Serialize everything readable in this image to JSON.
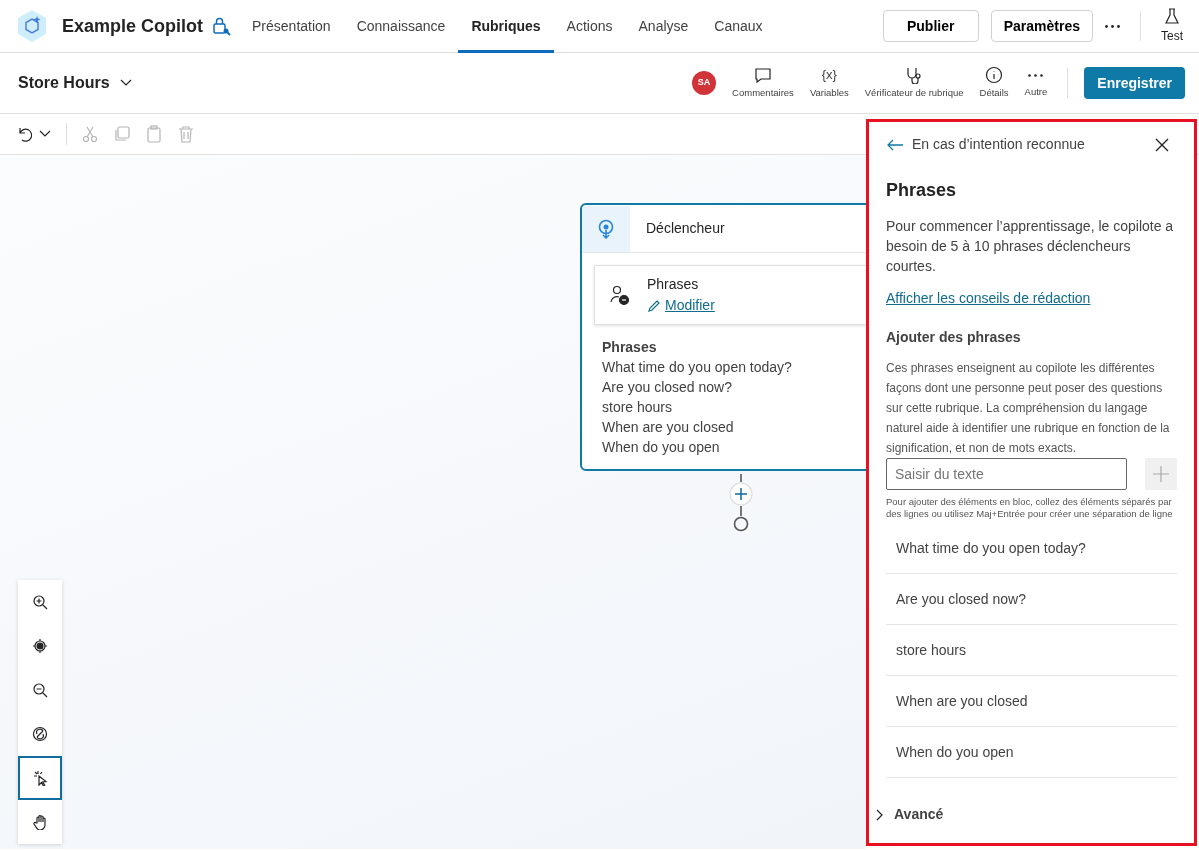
{
  "app": {
    "name": "Example Copilot"
  },
  "nav_tabs": [
    {
      "label": "Présentation",
      "selected": false
    },
    {
      "label": "Connaissance",
      "selected": false
    },
    {
      "label": "Rubriques",
      "selected": true
    },
    {
      "label": "Actions",
      "selected": false
    },
    {
      "label": "Analyse",
      "selected": false
    },
    {
      "label": "Canaux",
      "selected": false
    }
  ],
  "header_buttons": [
    "Publier",
    "Paramètres"
  ],
  "test_label": "Test",
  "topic": {
    "title": "Store Hours",
    "avatar": "SA",
    "tools": [
      {
        "kind": "comment",
        "label": "Commentaires"
      },
      {
        "kind": "variables",
        "glyph": "{x}",
        "label": "Variables"
      },
      {
        "kind": "checker",
        "label": "Vérificateur de rubrique"
      },
      {
        "kind": "info",
        "label": "Détails"
      },
      {
        "kind": "more",
        "label": "Autre"
      }
    ],
    "save": "Enregistrer"
  },
  "canvas": {
    "node": {
      "title": "Déclencheur",
      "card_title": "Phrases",
      "card_link": "Modifier",
      "body_title": "Phrases",
      "lines": [
        "What time do you open today?",
        "Are you closed now?",
        "store hours",
        "When are you closed",
        "When do you open"
      ]
    },
    "zoom_tools": [
      {
        "kind": "zoom-in",
        "selected": false
      },
      {
        "kind": "center",
        "selected": false
      },
      {
        "kind": "zoom-out",
        "selected": false
      },
      {
        "kind": "minimap",
        "selected": false
      },
      {
        "kind": "select",
        "selected": true
      },
      {
        "kind": "pan",
        "selected": false
      }
    ]
  },
  "panel": {
    "back": "En cas d’intention reconnue",
    "title": "Phrases",
    "description": "Pour commencer l’apprentissage, le copilote a besoin de 5 à 10 phrases déclencheurs courtes.",
    "link": "Afficher les conseils de rédaction",
    "section_title": "Ajouter des phrases",
    "help": "Ces phrases enseignent au copilote les différentes façons dont une personne peut poser des questions sur cette rubrique. La compréhension du langage naturel aide à identifier une rubrique en fonction de la signification, et non de mots exacts.",
    "placeholder": "Saisir du texte",
    "hint": "Pour ajouter des éléments en bloc, collez des éléments séparés par des lignes ou utilisez Maj+Entrée pour créer une séparation de ligne",
    "phrases": [
      "What time do you open today?",
      "Are you closed now?",
      "store hours",
      "When are you closed",
      "When do you open"
    ],
    "advanced": {
      "label": "Avancé",
      "expanded": false
    }
  }
}
